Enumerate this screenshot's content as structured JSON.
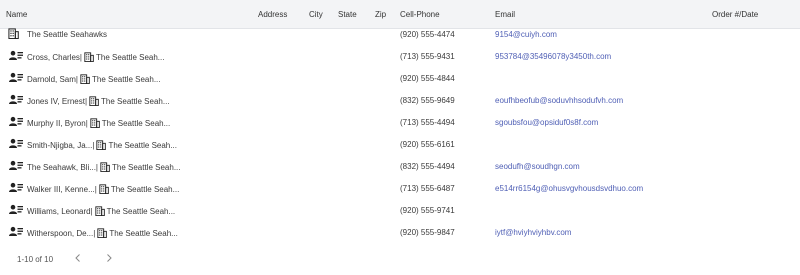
{
  "columns": [
    "Name",
    "Address",
    "City",
    "State",
    "Zip",
    "Cell-Phone",
    "Email",
    "Order #/Date"
  ],
  "rows": [
    {
      "type": "company",
      "name": "The Seattle Seahawks",
      "company": "",
      "phone": "(920) 555-4474",
      "email": "9154@cuiyh.com"
    },
    {
      "type": "person",
      "name": "Cross, Charles",
      "company": "The Seattle Seah...",
      "phone": "(713) 555-9431",
      "email": "953784@35496078y3450th.com"
    },
    {
      "type": "person",
      "name": "Darnold, Sam",
      "company": "The Seattle Seah...",
      "phone": "(920) 555-4844",
      "email": ""
    },
    {
      "type": "person",
      "name": "Jones IV, Ernest",
      "company": "The Seattle Seah...",
      "phone": "(832) 555-9649",
      "email": "eoufhbeofub@soduvhhsodufvh.com"
    },
    {
      "type": "person",
      "name": "Murphy II, Byron",
      "company": "The Seattle Seah...",
      "phone": "(713) 555-4494",
      "email": "sgoubsfou@opsiduf0s8f.com"
    },
    {
      "type": "person",
      "name": "Smith-Njigba, Ja...",
      "company": "The Seattle Seah...",
      "phone": "(920) 555-6161",
      "email": ""
    },
    {
      "type": "person",
      "name": "The Seahawk, Bli...",
      "company": "The Seattle Seah...",
      "phone": "(832) 555-4494",
      "email": "seodufh@soudhgn.com"
    },
    {
      "type": "person",
      "name": "Walker III, Kenne...",
      "company": "The Seattle Seah...",
      "phone": "(713) 555-6487",
      "email": "e514rr6154g@ohusvgvhousdsvdhuo.com"
    },
    {
      "type": "person",
      "name": "Williams, Leonard",
      "company": "The Seattle Seah...",
      "phone": "(920) 555-9741",
      "email": ""
    },
    {
      "type": "person",
      "name": "Witherspoon, De...",
      "company": "The Seattle Seah...",
      "phone": "(920) 555-9847",
      "email": "iytf@hviyhviyhbv.com"
    }
  ],
  "pagination": {
    "label": "1-10 of 10"
  },
  "colors": {
    "header_bg": "#f3f4f6",
    "link": "#4f5fb5",
    "text": "#3a3a3a"
  },
  "icons": {
    "person": "contact-card-icon",
    "company": "building-icon"
  }
}
